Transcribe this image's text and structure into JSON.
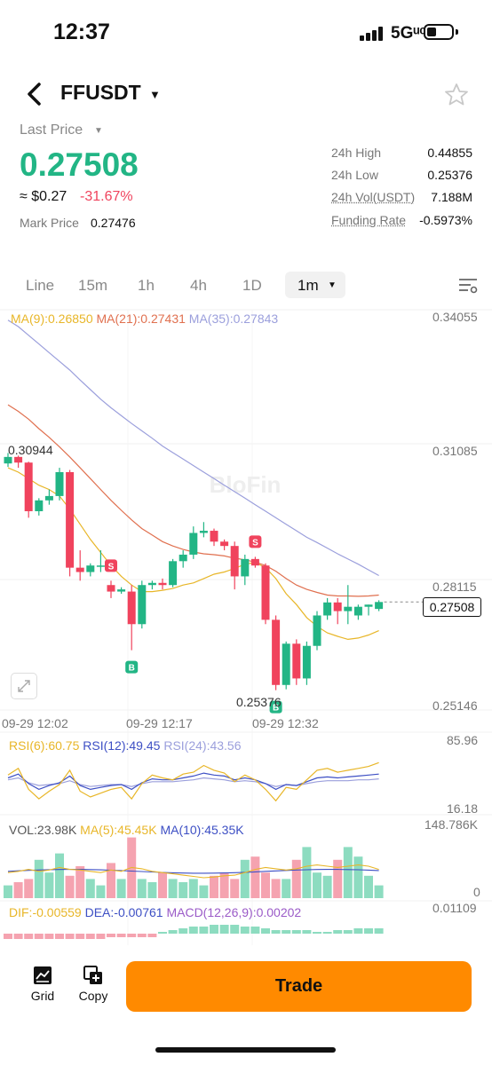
{
  "status_bar": {
    "time": "12:37",
    "network": "5Gᵘᶜ"
  },
  "header": {
    "pair": "FFUSDT"
  },
  "ticker": {
    "last_price_label": "Last Price",
    "last_price": "0.27508",
    "usd_approx": "≈ $0.27",
    "change_pct": "-31.67%",
    "mark_price_label": "Mark Price",
    "mark_price": "0.27476",
    "stats": [
      {
        "label": "24h High",
        "value": "0.44855"
      },
      {
        "label": "24h Low",
        "value": "0.25376"
      },
      {
        "label": "24h Vol(USDT)",
        "value": "7.188M"
      },
      {
        "label": "Funding Rate",
        "value": "-0.5973%"
      }
    ]
  },
  "tabs": [
    "Line",
    "15m",
    "1h",
    "4h",
    "1D"
  ],
  "active_tab": "1m",
  "colors": {
    "up": "#22b585",
    "down": "#f0435d",
    "ma9": "#e8b628",
    "ma21": "#e0704f",
    "ma35": "#9b9fdc",
    "accent": "#ff8a00"
  },
  "chart_data": {
    "type": "candlestick",
    "ma_legend": {
      "ma9": "MA(9):0.26850",
      "ma21": "MA(21):0.27431",
      "ma35": "MA(35):0.27843"
    },
    "y_ticks": [
      "0.34055",
      "0.31085",
      "0.28115",
      "0.25146"
    ],
    "x_ticks": [
      "09-29 12:02",
      "09-29 12:17",
      "09-29 12:32"
    ],
    "watermark": "BloFin",
    "current_price_tag": "0.27508",
    "high_marker": "0.30944",
    "low_marker": "0.25376",
    "candles": [
      [
        0.307,
        0.3094,
        0.3062,
        0.3085
      ],
      [
        0.3085,
        0.3088,
        0.306,
        0.3072
      ],
      [
        0.3072,
        0.3074,
        0.2945,
        0.296
      ],
      [
        0.296,
        0.299,
        0.295,
        0.2985
      ],
      [
        0.2985,
        0.301,
        0.2975,
        0.2995
      ],
      [
        0.2995,
        0.306,
        0.2985,
        0.305
      ],
      [
        0.305,
        0.3055,
        0.281,
        0.283
      ],
      [
        0.283,
        0.287,
        0.28,
        0.282
      ],
      [
        0.282,
        0.284,
        0.281,
        0.2835
      ],
      [
        0.2835,
        0.287,
        0.282,
        0.2835
      ],
      [
        0.279,
        0.28,
        0.276,
        0.2775
      ],
      [
        0.2775,
        0.2785,
        0.277,
        0.278
      ],
      [
        0.2775,
        0.279,
        0.264,
        0.27
      ],
      [
        0.27,
        0.28,
        0.269,
        0.279
      ],
      [
        0.279,
        0.28,
        0.278,
        0.2795
      ],
      [
        0.2795,
        0.2805,
        0.278,
        0.279
      ],
      [
        0.279,
        0.285,
        0.2785,
        0.2845
      ],
      [
        0.2845,
        0.287,
        0.283,
        0.286
      ],
      [
        0.286,
        0.2925,
        0.285,
        0.291
      ],
      [
        0.291,
        0.2935,
        0.29,
        0.2915
      ],
      [
        0.2915,
        0.292,
        0.288,
        0.289
      ],
      [
        0.289,
        0.2895,
        0.287,
        0.288
      ],
      [
        0.288,
        0.289,
        0.278,
        0.281
      ],
      [
        0.281,
        0.286,
        0.279,
        0.285
      ],
      [
        0.285,
        0.2855,
        0.283,
        0.2835
      ],
      [
        0.2835,
        0.284,
        0.27,
        0.271
      ],
      [
        0.271,
        0.272,
        0.2548,
        0.256
      ],
      [
        0.256,
        0.266,
        0.255,
        0.2655
      ],
      [
        0.2655,
        0.2665,
        0.256,
        0.2575
      ],
      [
        0.2575,
        0.266,
        0.256,
        0.265
      ],
      [
        0.265,
        0.273,
        0.264,
        0.272
      ],
      [
        0.272,
        0.276,
        0.271,
        0.275
      ],
      [
        0.275,
        0.276,
        0.27,
        0.273
      ],
      [
        0.273,
        0.279,
        0.27,
        0.274
      ],
      [
        0.272,
        0.2745,
        0.271,
        0.274
      ],
      [
        0.274,
        0.2745,
        0.272,
        0.2745
      ],
      [
        0.2735,
        0.2755,
        0.273,
        0.2751
      ]
    ],
    "ma9": [
      0.306,
      0.305,
      0.3035,
      0.302,
      0.301,
      0.2995,
      0.2965,
      0.293,
      0.2895,
      0.2865,
      0.2835,
      0.281,
      0.279,
      0.2775,
      0.2775,
      0.2778,
      0.2782,
      0.279,
      0.2795,
      0.2805,
      0.2815,
      0.282,
      0.2828,
      0.2838,
      0.2842,
      0.283,
      0.2805,
      0.277,
      0.2745,
      0.2715,
      0.2695,
      0.268,
      0.2672,
      0.2665,
      0.2668,
      0.2675,
      0.2685
    ],
    "ma21": [
      0.3205,
      0.319,
      0.3172,
      0.315,
      0.313,
      0.3108,
      0.3085,
      0.306,
      0.3035,
      0.301,
      0.2985,
      0.2962,
      0.294,
      0.292,
      0.2905,
      0.289,
      0.288,
      0.2872,
      0.2866,
      0.2862,
      0.286,
      0.2857,
      0.2852,
      0.2848,
      0.2843,
      0.2835,
      0.2822,
      0.2805,
      0.279,
      0.278,
      0.2773,
      0.2767,
      0.2765,
      0.2765,
      0.2764,
      0.2765,
      0.2767
    ],
    "ma35": [
      0.34,
      0.3385,
      0.3365,
      0.3345,
      0.3325,
      0.3305,
      0.3285,
      0.3262,
      0.324,
      0.3218,
      0.3198,
      0.318,
      0.3162,
      0.3145,
      0.3128,
      0.311,
      0.3095,
      0.308,
      0.3065,
      0.305,
      0.3035,
      0.302,
      0.3005,
      0.299,
      0.2975,
      0.296,
      0.2945,
      0.293,
      0.2915,
      0.29,
      0.2888,
      0.2875,
      0.2862,
      0.285,
      0.2838,
      0.2825,
      0.2812
    ],
    "rsi": {
      "legend": {
        "rsi6": "RSI(6):60.75",
        "rsi12": "RSI(12):49.45",
        "rsi24": "RSI(24):43.56"
      },
      "y_ticks": [
        "85.96",
        "16.18"
      ]
    },
    "volume": {
      "legend": {
        "vol": "VOL:23.98K",
        "ma5": "MA(5):45.45K",
        "ma10": "MA(10):45.35K"
      },
      "y_ticks": [
        "148.786K",
        "0"
      ]
    },
    "macd": {
      "legend": {
        "dif": "DIF:-0.00559",
        "dea": "DEA:-0.00761",
        "macd": "MACD(12,26,9):0.00202"
      },
      "y_ticks": [
        "0.01109"
      ]
    }
  },
  "bottom": {
    "grid_label": "Grid",
    "copy_label": "Copy",
    "trade_label": "Trade"
  }
}
